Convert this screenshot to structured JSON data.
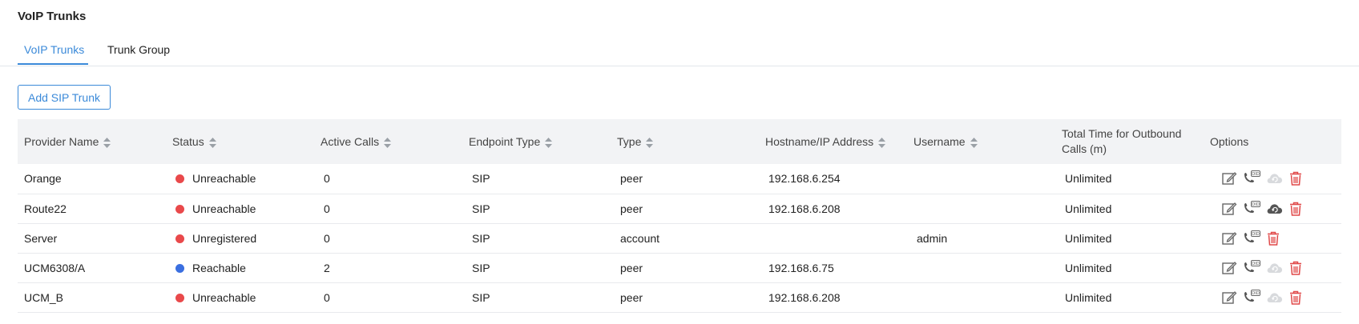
{
  "page": {
    "title": "VoIP Trunks"
  },
  "tabs": [
    {
      "label": "VoIP Trunks",
      "active": true
    },
    {
      "label": "Trunk Group",
      "active": false
    }
  ],
  "toolbar": {
    "add_label": "Add SIP Trunk"
  },
  "colors": {
    "accent": "#3b8ad9",
    "status_red": "#e9494b",
    "status_blue": "#3b6fe0",
    "delete_red": "#e04848"
  },
  "table": {
    "columns": {
      "provider": "Provider Name",
      "status": "Status",
      "active_calls": "Active Calls",
      "endpoint_type": "Endpoint Type",
      "type": "Type",
      "host": "Hostname/IP Address",
      "username": "Username",
      "total_time": "Total Time for Outbound Calls (m)",
      "options": "Options"
    },
    "rows": [
      {
        "provider": "Orange",
        "status": "Unreachable",
        "status_color": "red",
        "active_calls": "0",
        "endpoint_type": "SIP",
        "type": "peer",
        "host": "192.168.6.254",
        "username": "",
        "total_time": "Unlimited",
        "icons": [
          "edit-icon",
          "did-phone-icon",
          "cloud-sync-icon",
          "trash-icon"
        ],
        "cloud_enabled": false
      },
      {
        "provider": "Route22",
        "status": "Unreachable",
        "status_color": "red",
        "active_calls": "0",
        "endpoint_type": "SIP",
        "type": "peer",
        "host": "192.168.6.208",
        "username": "",
        "total_time": "Unlimited",
        "icons": [
          "edit-icon",
          "did-phone-icon",
          "cloud-sync-icon",
          "trash-icon"
        ],
        "cloud_enabled": true
      },
      {
        "provider": "Server",
        "status": "Unregistered",
        "status_color": "red",
        "active_calls": "0",
        "endpoint_type": "SIP",
        "type": "account",
        "host": "",
        "username": "admin",
        "total_time": "Unlimited",
        "icons": [
          "edit-icon",
          "did-phone-icon",
          "trash-icon"
        ],
        "cloud_enabled": false
      },
      {
        "provider": "UCM6308/A",
        "status": "Reachable",
        "status_color": "blue",
        "active_calls": "2",
        "endpoint_type": "SIP",
        "type": "peer",
        "host": "192.168.6.75",
        "username": "",
        "total_time": "Unlimited",
        "icons": [
          "edit-icon",
          "did-phone-icon",
          "cloud-sync-icon",
          "trash-icon"
        ],
        "cloud_enabled": false
      },
      {
        "provider": "UCM_B",
        "status": "Unreachable",
        "status_color": "red",
        "active_calls": "0",
        "endpoint_type": "SIP",
        "type": "peer",
        "host": "192.168.6.208",
        "username": "",
        "total_time": "Unlimited",
        "icons": [
          "edit-icon",
          "did-phone-icon",
          "cloud-sync-icon",
          "trash-icon"
        ],
        "cloud_enabled": false
      }
    ]
  }
}
